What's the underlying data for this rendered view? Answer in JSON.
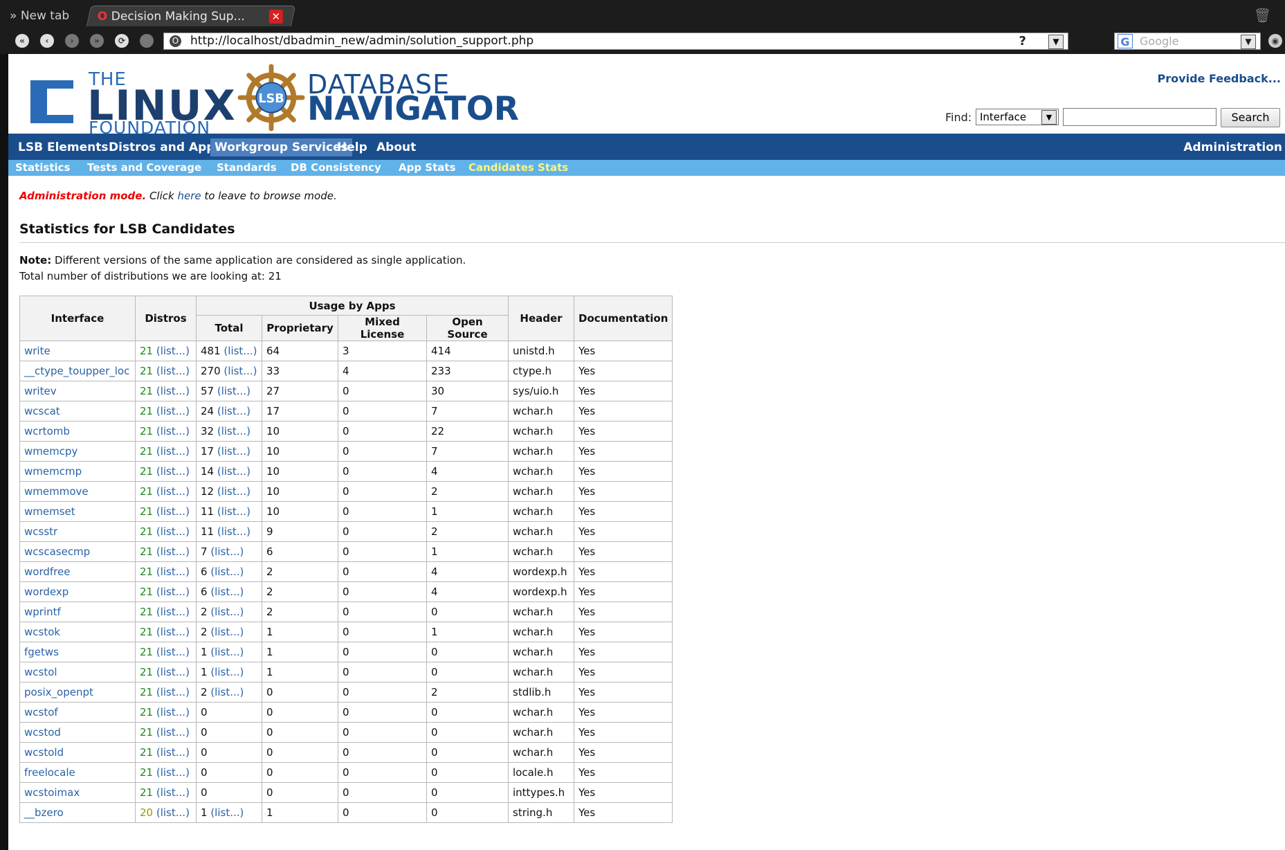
{
  "browser": {
    "tabs": [
      {
        "label": "New tab"
      },
      {
        "label": "Decision Making Sup..."
      }
    ],
    "url": "http://localhost/dbadmin_new/admin/solution_support.php",
    "search_placeholder": "Google",
    "help_glyph": "?"
  },
  "header": {
    "logo_the": "THE",
    "logo_linux": "LINUX",
    "logo_foundation": "FOUNDATION",
    "lsb_badge": "LSB",
    "db_line1": "DATABASE",
    "db_line2": "NAVIGATOR",
    "feedback": "Provide Feedback...",
    "find_label": "Find:",
    "find_select": "Interface",
    "search_button": "Search"
  },
  "mainnav": {
    "items": [
      "LSB Elements",
      "Distros and Apps",
      "Workgroup Services",
      "Help",
      "About"
    ],
    "active": "Workgroup Services",
    "admin": "Administration"
  },
  "subnav": {
    "items": [
      "Statistics",
      "Tests and Coverage",
      "Standards",
      "DB Consistency",
      "App Stats",
      "Candidates Stats"
    ],
    "active": "Candidates Stats"
  },
  "admin_note": {
    "mode": "Administration mode.",
    "click": " Click ",
    "here": "here",
    "rest": " to leave to browse mode."
  },
  "page_title": "Statistics for LSB Candidates",
  "note": {
    "bold": "Note:",
    "text": " Different versions of the same application are considered as single application.",
    "total": "Total number of distributions we are looking at: 21"
  },
  "table": {
    "headers": {
      "interface": "Interface",
      "distros": "Distros",
      "usage": "Usage by Apps",
      "total": "Total",
      "proprietary": "Proprietary",
      "mixed": "Mixed License",
      "open": "Open Source",
      "header": "Header",
      "documentation": "Documentation"
    },
    "list_label": "(list...)",
    "rows": [
      {
        "iface": "write",
        "distros": "21",
        "total": "481",
        "has_list": true,
        "prop": "64",
        "mixed": "3",
        "open": "414",
        "header": "unistd.h",
        "doc": "Yes"
      },
      {
        "iface": "__ctype_toupper_loc",
        "distros": "21",
        "total": "270",
        "has_list": true,
        "prop": "33",
        "mixed": "4",
        "open": "233",
        "header": "ctype.h",
        "doc": "Yes"
      },
      {
        "iface": "writev",
        "distros": "21",
        "total": "57",
        "has_list": true,
        "prop": "27",
        "mixed": "0",
        "open": "30",
        "header": "sys/uio.h",
        "doc": "Yes"
      },
      {
        "iface": "wcscat",
        "distros": "21",
        "total": "24",
        "has_list": true,
        "prop": "17",
        "mixed": "0",
        "open": "7",
        "header": "wchar.h",
        "doc": "Yes"
      },
      {
        "iface": "wcrtomb",
        "distros": "21",
        "total": "32",
        "has_list": true,
        "prop": "10",
        "mixed": "0",
        "open": "22",
        "header": "wchar.h",
        "doc": "Yes"
      },
      {
        "iface": "wmemcpy",
        "distros": "21",
        "total": "17",
        "has_list": true,
        "prop": "10",
        "mixed": "0",
        "open": "7",
        "header": "wchar.h",
        "doc": "Yes"
      },
      {
        "iface": "wmemcmp",
        "distros": "21",
        "total": "14",
        "has_list": true,
        "prop": "10",
        "mixed": "0",
        "open": "4",
        "header": "wchar.h",
        "doc": "Yes"
      },
      {
        "iface": "wmemmove",
        "distros": "21",
        "total": "12",
        "has_list": true,
        "prop": "10",
        "mixed": "0",
        "open": "2",
        "header": "wchar.h",
        "doc": "Yes"
      },
      {
        "iface": "wmemset",
        "distros": "21",
        "total": "11",
        "has_list": true,
        "prop": "10",
        "mixed": "0",
        "open": "1",
        "header": "wchar.h",
        "doc": "Yes"
      },
      {
        "iface": "wcsstr",
        "distros": "21",
        "total": "11",
        "has_list": true,
        "prop": "9",
        "mixed": "0",
        "open": "2",
        "header": "wchar.h",
        "doc": "Yes"
      },
      {
        "iface": "wcscasecmp",
        "distros": "21",
        "total": "7",
        "has_list": true,
        "prop": "6",
        "mixed": "0",
        "open": "1",
        "header": "wchar.h",
        "doc": "Yes"
      },
      {
        "iface": "wordfree",
        "distros": "21",
        "total": "6",
        "has_list": true,
        "prop": "2",
        "mixed": "0",
        "open": "4",
        "header": "wordexp.h",
        "doc": "Yes"
      },
      {
        "iface": "wordexp",
        "distros": "21",
        "total": "6",
        "has_list": true,
        "prop": "2",
        "mixed": "0",
        "open": "4",
        "header": "wordexp.h",
        "doc": "Yes"
      },
      {
        "iface": "wprintf",
        "distros": "21",
        "total": "2",
        "has_list": true,
        "prop": "2",
        "mixed": "0",
        "open": "0",
        "header": "wchar.h",
        "doc": "Yes"
      },
      {
        "iface": "wcstok",
        "distros": "21",
        "total": "2",
        "has_list": true,
        "prop": "1",
        "mixed": "0",
        "open": "1",
        "header": "wchar.h",
        "doc": "Yes"
      },
      {
        "iface": "fgetws",
        "distros": "21",
        "total": "1",
        "has_list": true,
        "prop": "1",
        "mixed": "0",
        "open": "0",
        "header": "wchar.h",
        "doc": "Yes"
      },
      {
        "iface": "wcstol",
        "distros": "21",
        "total": "1",
        "has_list": true,
        "prop": "1",
        "mixed": "0",
        "open": "0",
        "header": "wchar.h",
        "doc": "Yes"
      },
      {
        "iface": "posix_openpt",
        "distros": "21",
        "total": "2",
        "has_list": true,
        "prop": "0",
        "mixed": "0",
        "open": "2",
        "header": "stdlib.h",
        "doc": "Yes"
      },
      {
        "iface": "wcstof",
        "distros": "21",
        "total": "0",
        "has_list": false,
        "prop": "0",
        "mixed": "0",
        "open": "0",
        "header": "wchar.h",
        "doc": "Yes"
      },
      {
        "iface": "wcstod",
        "distros": "21",
        "total": "0",
        "has_list": false,
        "prop": "0",
        "mixed": "0",
        "open": "0",
        "header": "wchar.h",
        "doc": "Yes"
      },
      {
        "iface": "wcstold",
        "distros": "21",
        "total": "0",
        "has_list": false,
        "prop": "0",
        "mixed": "0",
        "open": "0",
        "header": "wchar.h",
        "doc": "Yes"
      },
      {
        "iface": "freelocale",
        "distros": "21",
        "total": "0",
        "has_list": false,
        "prop": "0",
        "mixed": "0",
        "open": "0",
        "header": "locale.h",
        "doc": "Yes"
      },
      {
        "iface": "wcstoimax",
        "distros": "21",
        "total": "0",
        "has_list": false,
        "prop": "0",
        "mixed": "0",
        "open": "0",
        "header": "inttypes.h",
        "doc": "Yes"
      },
      {
        "iface": "__bzero",
        "distros": "20",
        "total": "1",
        "has_list": true,
        "prop": "1",
        "mixed": "0",
        "open": "0",
        "header": "string.h",
        "doc": "Yes"
      }
    ]
  },
  "colors": {
    "brand_blue": "#1a4d8c",
    "subnav_blue": "#61b2e8",
    "active_subnav": "#fff57a",
    "admin_red": "#ee0000",
    "distros_full": "#1a8a1a",
    "distros_partial": "#999900"
  },
  "icons": [
    "close-tab-icon",
    "back-icon",
    "forward-icon",
    "reload-icon",
    "home-icon",
    "opera-icon",
    "google-icon",
    "dropdown-arrow-icon",
    "trash-icon",
    "lsb-wheel-icon"
  ]
}
